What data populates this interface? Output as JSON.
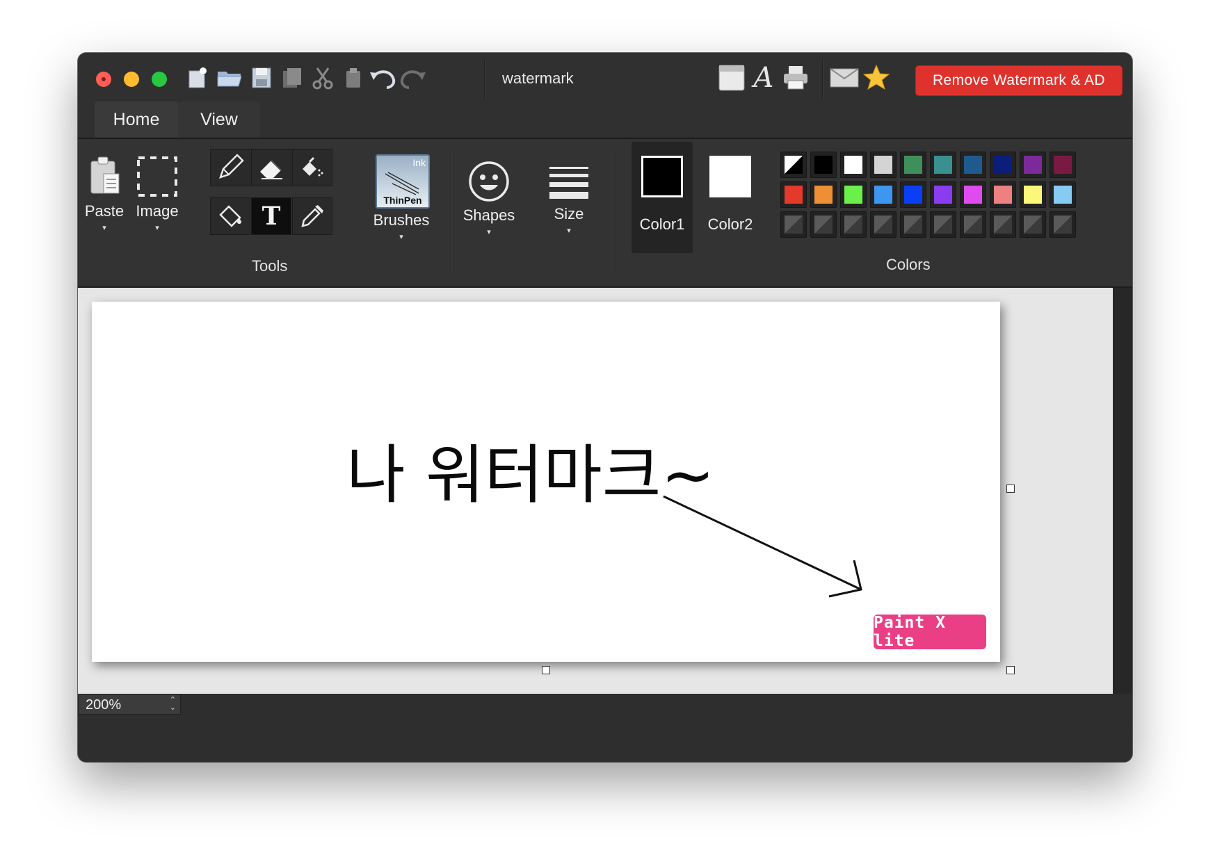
{
  "window": {
    "title": "watermark"
  },
  "titlebar": {
    "quick_tools": [
      "new-file-icon",
      "open-folder-icon",
      "save-icon",
      "copy-icon",
      "cut-icon",
      "paste-icon",
      "undo-icon",
      "redo-icon"
    ],
    "right_tools": [
      "window-icon",
      "font-icon",
      "printer-icon",
      "mail-icon",
      "star-icon"
    ],
    "promo_button": "Remove Watermark & AD"
  },
  "tabs": [
    {
      "label": "Home"
    },
    {
      "label": "View"
    }
  ],
  "ribbon": {
    "paste_label": "Paste",
    "image_label": "Image",
    "tools_group": "Tools",
    "brush_thumb_top": "Ink",
    "brush_thumb_name": "ThinPen",
    "brushes_label": "Brushes",
    "shapes_label": "Shapes",
    "size_label": "Size",
    "color1_label": "Color1",
    "color2_label": "Color2",
    "colors_group": "Colors",
    "caret": "▾",
    "color1": "#000000",
    "color2": "#ffffff",
    "palette_row1": [
      "swap",
      "#000000",
      "#ffffff",
      "#d4d4d4",
      "#3f8f5a",
      "#3a8f8f",
      "#1f5a8f",
      "#0b1f7a",
      "#7c2a9a",
      "#7a1a42"
    ],
    "palette_row2": [
      "#e5392a",
      "#ef8f35",
      "#6bf04a",
      "#3d97f0",
      "#0a3ff5",
      "#8b3cf0",
      "#e04bef",
      "#ef8080",
      "#faf77a",
      "#86cbf3"
    ]
  },
  "canvas": {
    "text": "나 워터마크~",
    "badge": "Paint X lite"
  },
  "status": {
    "zoom": "200%"
  }
}
